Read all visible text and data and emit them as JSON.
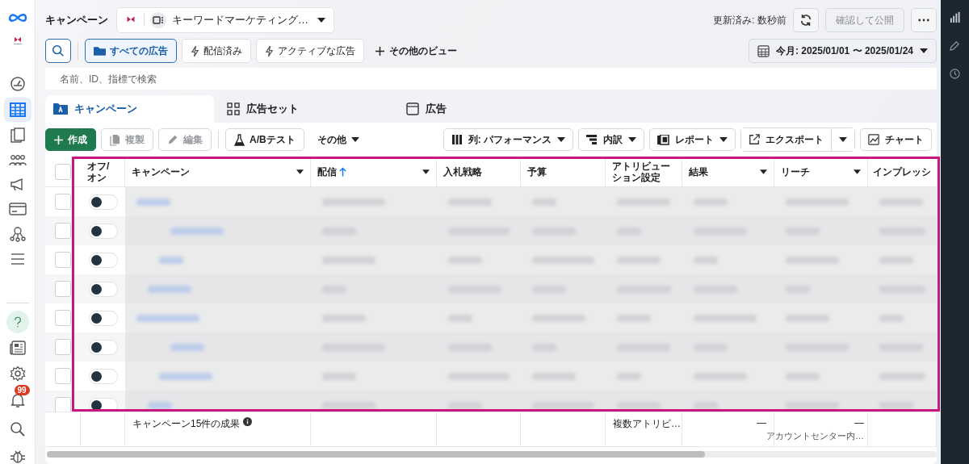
{
  "header": {
    "title": "キャンペーン",
    "account": "キーワードマーケティング…",
    "updated": "更新済み: 数秒前",
    "publish": "確認して公開",
    "publish_disabled": true
  },
  "views": [
    {
      "label": "すべての広告",
      "selected": true
    },
    {
      "label": "配信済み",
      "selected": false
    },
    {
      "label": "アクティブな広告",
      "selected": false
    }
  ],
  "more_views": "その他のビュー",
  "date_range": "今月: 2025/01/01 〜 2025/01/24",
  "search": {
    "placeholder": "名前、ID、指標で検索"
  },
  "level_tabs": [
    {
      "label": "キャンペーン",
      "selected": true
    },
    {
      "label": "広告セット",
      "selected": false
    },
    {
      "label": "広告",
      "selected": false
    }
  ],
  "actions": [
    {
      "label": "作成",
      "kind": "primary",
      "disabled": false
    },
    {
      "label": "複製",
      "kind": "copy",
      "disabled": true
    },
    {
      "label": "編集",
      "kind": "edit",
      "disabled": true
    },
    {
      "label": "A/Bテスト",
      "kind": "flask",
      "disabled": false
    },
    {
      "label": "その他",
      "kind": "menu",
      "disabled": false
    }
  ],
  "tools": [
    {
      "label": "列: パフォーマンス",
      "kind": "columns"
    },
    {
      "label": "内訳",
      "kind": "breakdown"
    },
    {
      "label": "レポート",
      "kind": "report"
    },
    {
      "label": "エクスポート",
      "kind": "export"
    },
    {
      "label": "チャート",
      "kind": "chart"
    }
  ],
  "table": {
    "select_all": false,
    "columns": [
      {
        "label": "オフ/オン",
        "menu": false,
        "sorted": false
      },
      {
        "label": "キャンペーン",
        "menu": true,
        "sorted": false
      },
      {
        "label": "配信",
        "menu": true,
        "sorted": true
      },
      {
        "label": "入札戦略",
        "menu": false,
        "sorted": false
      },
      {
        "label": "予算",
        "menu": false,
        "sorted": false
      },
      {
        "label": "アトリビューション設定",
        "menu": false,
        "sorted": false
      },
      {
        "label": "結果",
        "menu": true,
        "sorted": false
      },
      {
        "label": "リーチ",
        "menu": true,
        "sorted": false
      },
      {
        "label": "インプレッシ",
        "menu": false,
        "sorted": false
      }
    ],
    "rows": [
      {
        "selected": false,
        "on": false
      },
      {
        "selected": false,
        "on": false
      },
      {
        "selected": false,
        "on": false
      },
      {
        "selected": false,
        "on": false
      },
      {
        "selected": false,
        "on": false
      },
      {
        "selected": false,
        "on": false
      },
      {
        "selected": false,
        "on": false
      },
      {
        "selected": false,
        "on": false
      }
    ],
    "footer": {
      "summary": "キャンペーン15件の成果",
      "attribution": "複数アトリビ…",
      "result": "—",
      "reach": "—",
      "reach_note": "アカウントセンター内…"
    }
  },
  "notifications": "99"
}
